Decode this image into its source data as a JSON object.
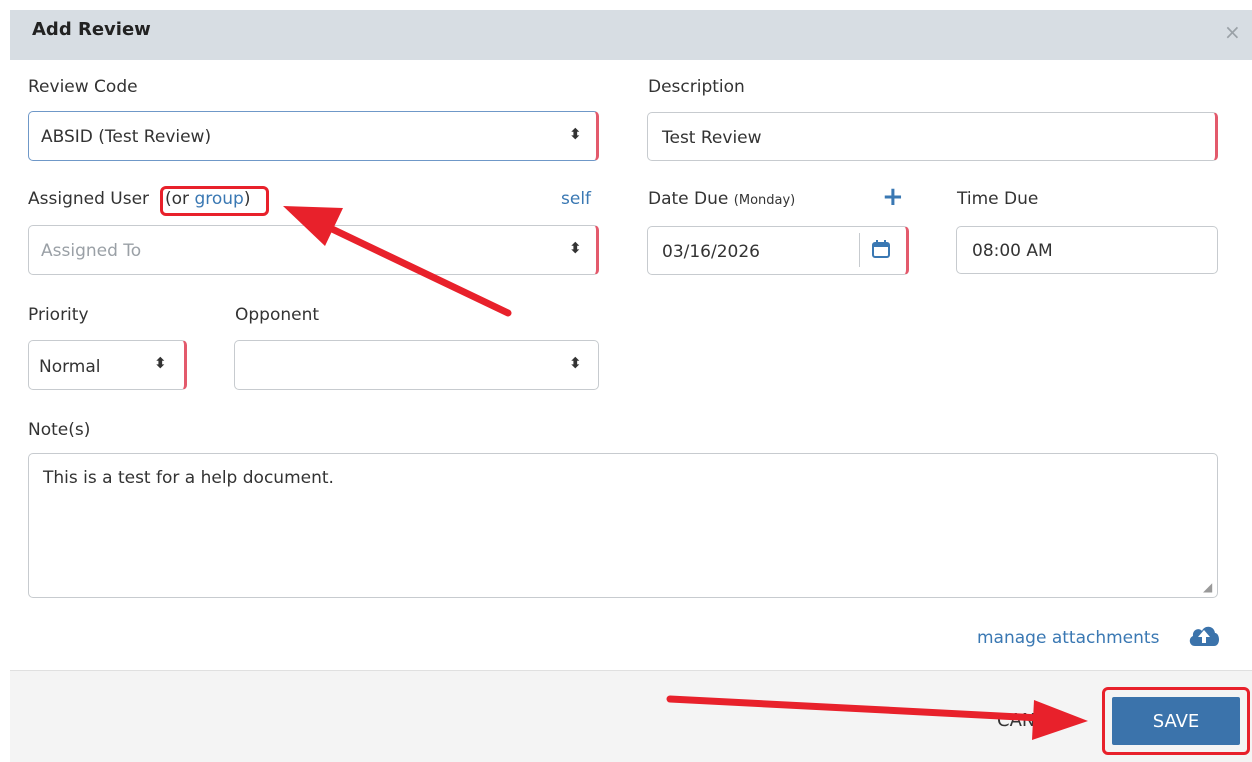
{
  "dialog": {
    "title": "Add Review",
    "close_glyph": "×"
  },
  "review_code": {
    "label": "Review Code",
    "value": "ABSID (Test Review)"
  },
  "description": {
    "label": "Description",
    "value": "Test Review"
  },
  "assigned": {
    "label": "Assigned User",
    "or_text": "(or ",
    "group_link": "group",
    "close_paren": ")",
    "self_link": "self",
    "placeholder": "Assigned To"
  },
  "date_due": {
    "label": "Date Due",
    "day": "(Monday)",
    "add_glyph": "+",
    "value": "03/16/2026"
  },
  "time_due": {
    "label": "Time Due",
    "value": "08:00 AM"
  },
  "priority": {
    "label": "Priority",
    "value": "Normal"
  },
  "opponent": {
    "label": "Opponent",
    "value": ""
  },
  "notes": {
    "label": "Note(s)",
    "value": "This is a test for a help document."
  },
  "attachments": {
    "link": "manage attachments",
    "icon": "cloud-upload-icon"
  },
  "footer": {
    "cancel_label": "CANCEL",
    "save_label": "SAVE"
  },
  "annotation": {
    "arrow_color": "#e8212b"
  },
  "colors": {
    "header_bg": "#d7dde3",
    "accent": "#3b73ab",
    "required_marker": "#e35a6c",
    "link": "#3a78b3"
  }
}
